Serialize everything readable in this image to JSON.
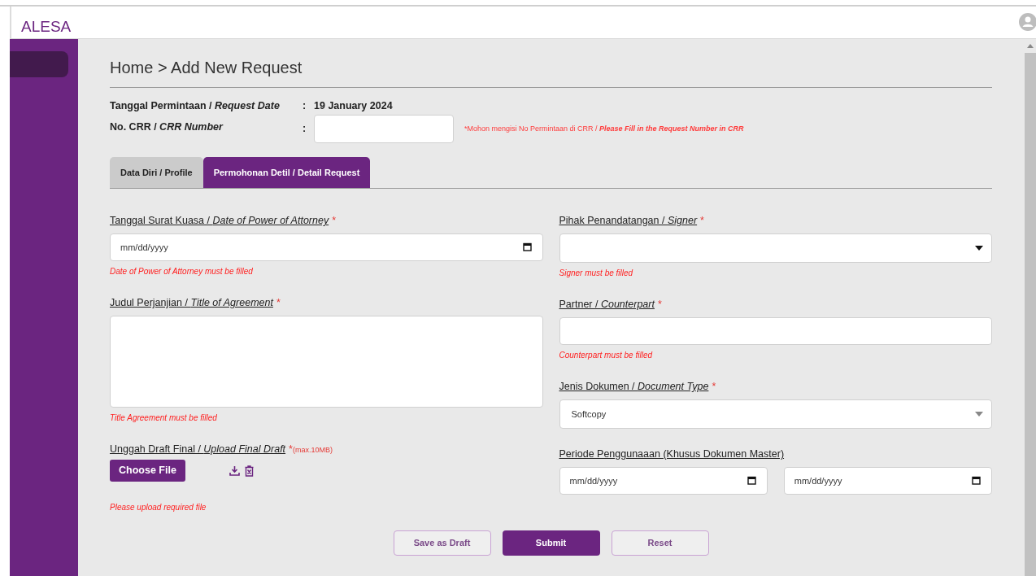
{
  "app": {
    "brand": "ALESA"
  },
  "breadcrumb": "Home > Add New Request",
  "request_info": [
    {
      "label": "Tanggal Permintaan / *Request Date*",
      "separator": ":",
      "value": "19 January 2024"
    }
  ],
  "crr": {
    "label": "No. CRR / *CRR Number*",
    "separator": ":",
    "note": {
      "text": "*Mohon mengisi No Permintaan di CRR / ",
      "emphasis": "Please Fill in the Request Number in CRR"
    }
  },
  "tabs": [
    {
      "label": "Data Diri / Profile",
      "selected": false
    },
    {
      "label": "Permohonan Detil / Detail Request",
      "selected": true
    }
  ],
  "left_fields": [
    {
      "kind": "date",
      "label": "Tanggal Surat Kuasa / *Date of Power of Attorney*",
      "required_mark": "*",
      "placeholder": "mm/dd/yyyy",
      "error": "Date of Power of Attorney must be filled"
    },
    {
      "kind": "textarea",
      "label": "Judul Perjanjian / *Title of Agreement*",
      "required_mark": "*",
      "error": "Title Agreement must be filled"
    },
    {
      "kind": "file",
      "label": "Unggah Draft Final / *Upload Final Draft*",
      "required_mark": "*",
      "note": "(max.10MB)",
      "button": "Choose File",
      "error": "Please upload required file"
    }
  ],
  "right_fields": [
    {
      "kind": "select",
      "label": "Pihak Penandatangan / *Signer*",
      "required_mark": "*",
      "disabled": false,
      "error": "Signer must be filled"
    },
    {
      "kind": "text",
      "label": "Partner / *Counterpart*",
      "required_mark": "*",
      "error": "Counterpart must be filled"
    },
    {
      "kind": "select",
      "label": "Jenis Dokumen / *Document Type*",
      "required_mark": "*",
      "disabled": true,
      "value": "Softcopy"
    },
    {
      "kind": "date-range",
      "label": "Periode Penggunaaan (Khusus Dokumen Master)",
      "placeholders": [
        "mm/dd/yyyy",
        "mm/dd/yyyy"
      ]
    }
  ],
  "actions": [
    {
      "kind": "outline",
      "label": "Save as Draft"
    },
    {
      "kind": "primary",
      "label": "Submit"
    },
    {
      "kind": "outline",
      "label": "Reset"
    }
  ]
}
